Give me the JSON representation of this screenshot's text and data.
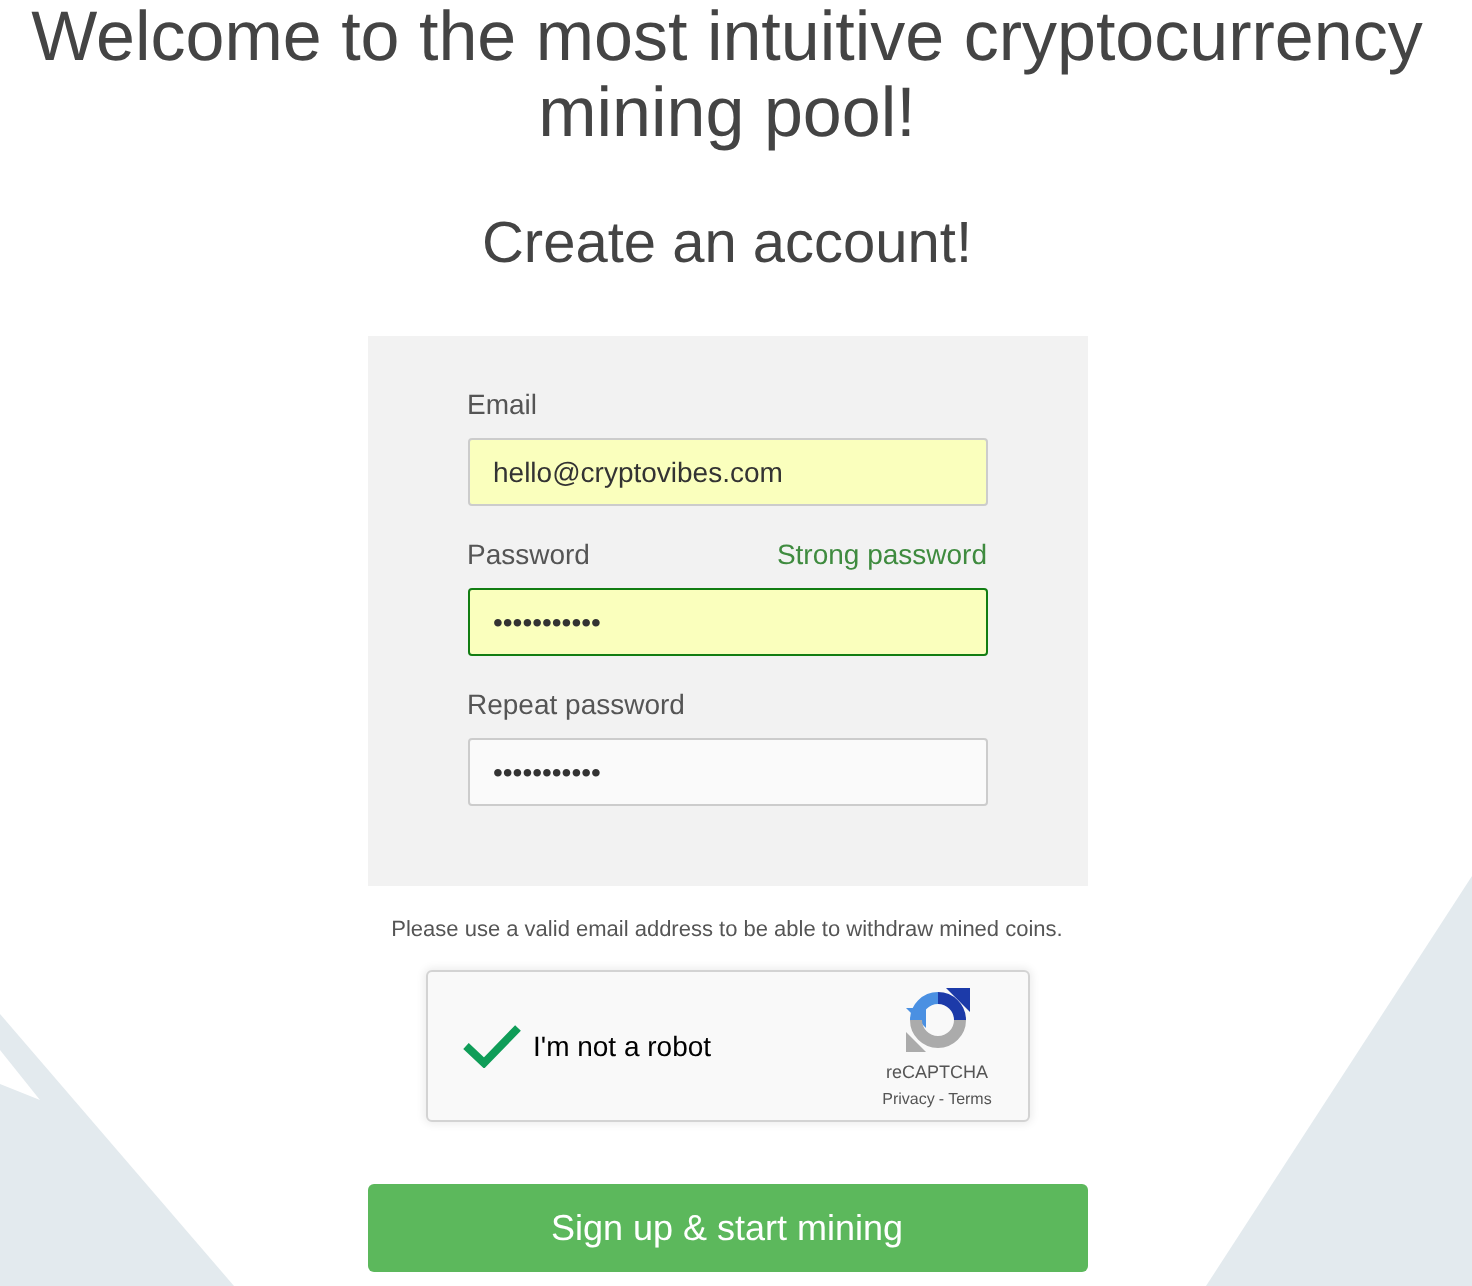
{
  "heading": "Welcome to the most intuitive cryptocurrency mining pool!",
  "subheading": "Create an account!",
  "form": {
    "fields": [
      {
        "label": "Email",
        "value": "hello@cryptovibes.com",
        "autofilled": true,
        "valid": false
      },
      {
        "label": "Password",
        "hint": "Strong password",
        "value": "•••••••••••",
        "autofilled": true,
        "valid": true
      },
      {
        "label": "Repeat password",
        "value": "•••••••••••",
        "autofilled": false,
        "valid": false
      }
    ]
  },
  "note": "Please use a valid email address to be able to withdraw mined coins.",
  "captcha": {
    "label": "I'm not a robot",
    "checked": true,
    "logo_text": "reCAPTCHA",
    "links": [
      "Privacy",
      "Terms"
    ],
    "separator": "-"
  },
  "submit_button": "Sign up & start mining"
}
